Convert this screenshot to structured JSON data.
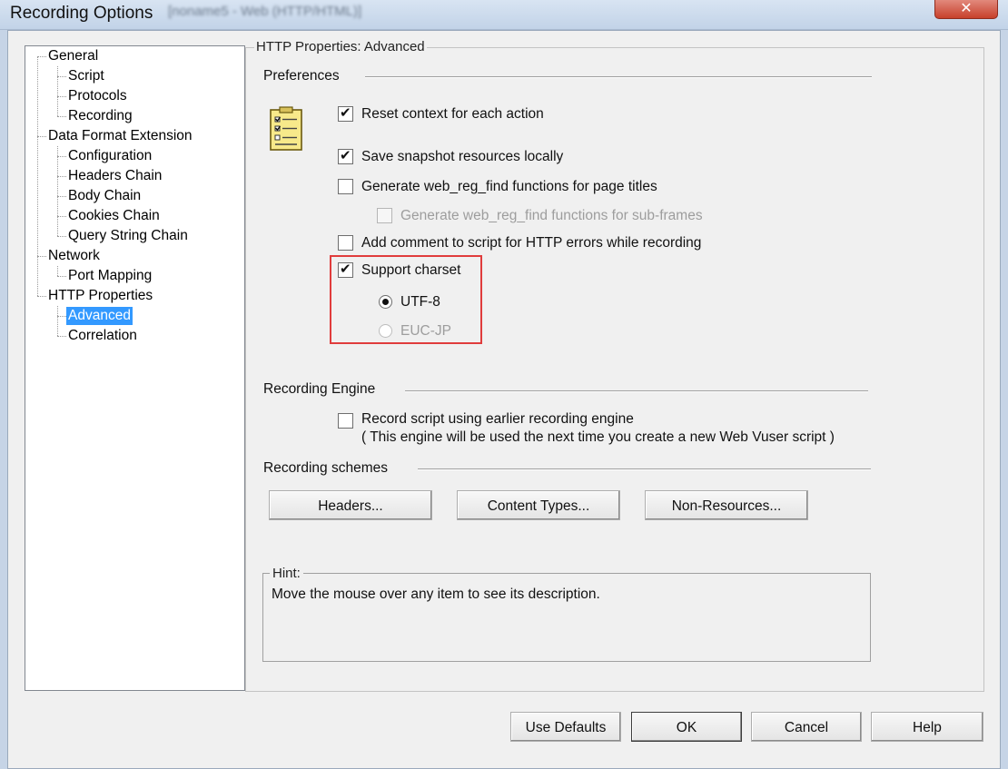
{
  "window": {
    "title": "Recording Options",
    "subtitle": "[noname5 - Web (HTTP/HTML)]",
    "close_symbol": "✕"
  },
  "tree": {
    "items": [
      {
        "label": "General",
        "level": 0
      },
      {
        "label": "Script",
        "level": 1
      },
      {
        "label": "Protocols",
        "level": 1
      },
      {
        "label": "Recording",
        "level": 1
      },
      {
        "label": "Data Format Extension",
        "level": 0
      },
      {
        "label": "Configuration",
        "level": 1
      },
      {
        "label": "Headers Chain",
        "level": 1
      },
      {
        "label": "Body Chain",
        "level": 1
      },
      {
        "label": "Cookies Chain",
        "level": 1
      },
      {
        "label": "Query String Chain",
        "level": 1
      },
      {
        "label": "Network",
        "level": 0
      },
      {
        "label": "Port Mapping",
        "level": 1
      },
      {
        "label": "HTTP Properties",
        "level": 0
      },
      {
        "label": "Advanced",
        "level": 1,
        "selected": true
      },
      {
        "label": "Correlation",
        "level": 1
      }
    ]
  },
  "pane": {
    "title": "HTTP Properties: Advanced",
    "preferences": {
      "heading": "Preferences",
      "options": [
        {
          "label": "Reset context for each action",
          "checked": true,
          "enabled": true
        },
        {
          "label": "Save snapshot resources locally",
          "checked": true,
          "enabled": true
        },
        {
          "label": "Generate web_reg_find functions for page titles",
          "checked": false,
          "enabled": true
        },
        {
          "label": "Generate web_reg_find functions for sub-frames",
          "checked": false,
          "enabled": false
        },
        {
          "label": "Add comment to script for HTTP errors while recording",
          "checked": false,
          "enabled": true
        },
        {
          "label": "Support charset",
          "checked": true,
          "enabled": true
        }
      ],
      "charset_options": [
        {
          "label": "UTF-8",
          "selected": true,
          "enabled": true
        },
        {
          "label": "EUC-JP",
          "selected": false,
          "enabled": false
        }
      ]
    },
    "recording_engine": {
      "heading": "Recording Engine",
      "option_label": "Record script using earlier recording engine",
      "checked": false,
      "note": "( This engine will be used the next time you create a new Web Vuser script )"
    },
    "recording_schemes": {
      "heading": "Recording schemes",
      "buttons": [
        "Headers...",
        "Content Types...",
        "Non-Resources..."
      ]
    },
    "hint": {
      "heading": "Hint:",
      "text": "Move the mouse over any item to see its description."
    }
  },
  "footer": {
    "buttons": [
      "Use Defaults",
      "OK",
      "Cancel",
      "Help"
    ]
  },
  "colors": {
    "highlight_border": "#e03c3c",
    "selection": "#3399ff"
  }
}
